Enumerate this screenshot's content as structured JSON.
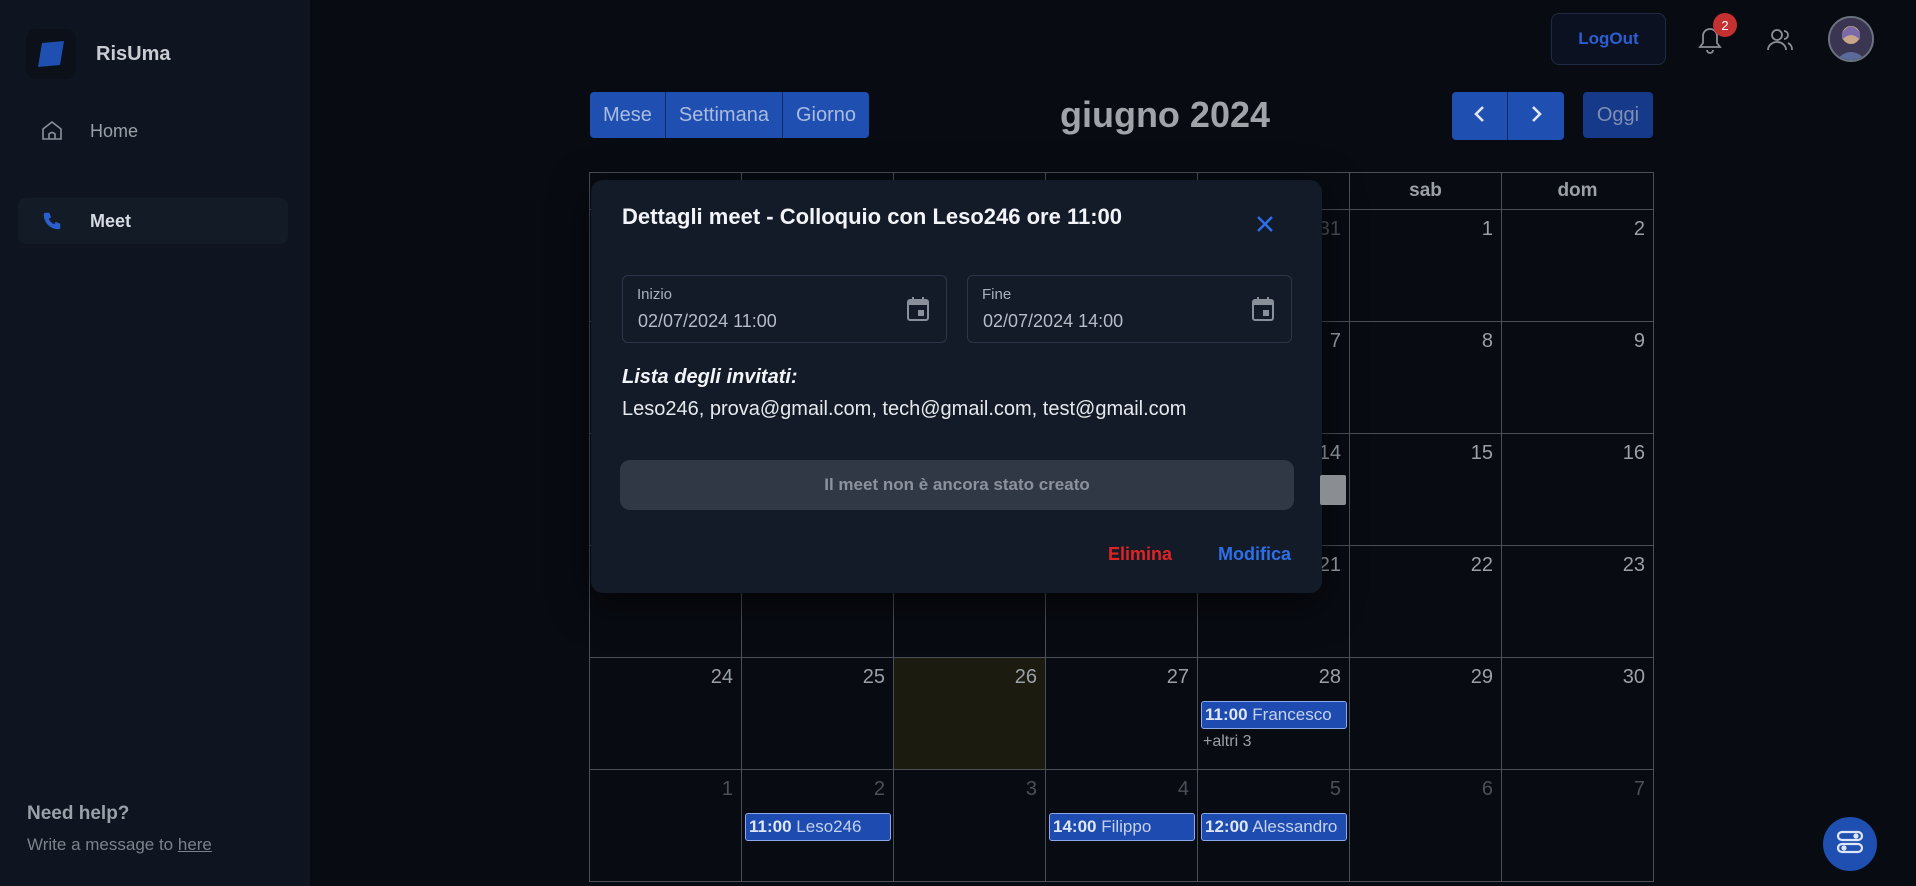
{
  "app": {
    "name": "RisUma"
  },
  "sidebar": {
    "items": [
      {
        "label": "Home",
        "icon": "home-icon"
      },
      {
        "label": "Meet",
        "icon": "phone-icon"
      }
    ],
    "help": {
      "title": "Need help?",
      "text": "Write a message to ",
      "link": "here"
    }
  },
  "topbar": {
    "logout_label": "LogOut",
    "notification_count": "2"
  },
  "calendar": {
    "views": [
      "Mese",
      "Settimana",
      "Giorno"
    ],
    "title": "giugno 2024",
    "today_label": "Oggi",
    "weekday_headers": [
      "",
      "",
      "",
      "",
      "",
      "sab",
      "dom"
    ],
    "weeks": [
      [
        "",
        "",
        "",
        "",
        "31",
        "1",
        "2"
      ],
      [
        "",
        "",
        "",
        "",
        "7",
        "8",
        "9"
      ],
      [
        "",
        "",
        "",
        "",
        "14",
        "15",
        "16"
      ],
      [
        "",
        "",
        "",
        "",
        "21",
        "22",
        "23"
      ],
      [
        "24",
        "25",
        "26",
        "27",
        "28",
        "29",
        "30"
      ],
      [
        "1",
        "2",
        "3",
        "4",
        "5",
        "6",
        "7"
      ]
    ],
    "events": {
      "e1_time": "11:00",
      "e1_name": "Francesco",
      "e1_more": "+altri 3",
      "e2_time": "11:00",
      "e2_name": "Leso246",
      "e3_time": "14:00",
      "e3_name": "Filippo",
      "e4_time": "12:00",
      "e4_name": "Alessandro"
    }
  },
  "modal": {
    "title": "Dettagli meet - Colloquio con Leso246 ore 11:00",
    "start_label": "Inizio",
    "start_value": "02/07/2024 11:00",
    "end_label": "Fine",
    "end_value": "02/07/2024 14:00",
    "invitees_title": "Lista degli invitati:",
    "invitees": "Leso246, prova@gmail.com, tech@gmail.com, test@gmail.com",
    "status": "Il meet non è ancora stato creato",
    "delete_label": "Elimina",
    "edit_label": "Modifica"
  },
  "colors": {
    "accent": "#1f4fb0",
    "danger": "#e02424",
    "link": "#2e6fe8"
  }
}
